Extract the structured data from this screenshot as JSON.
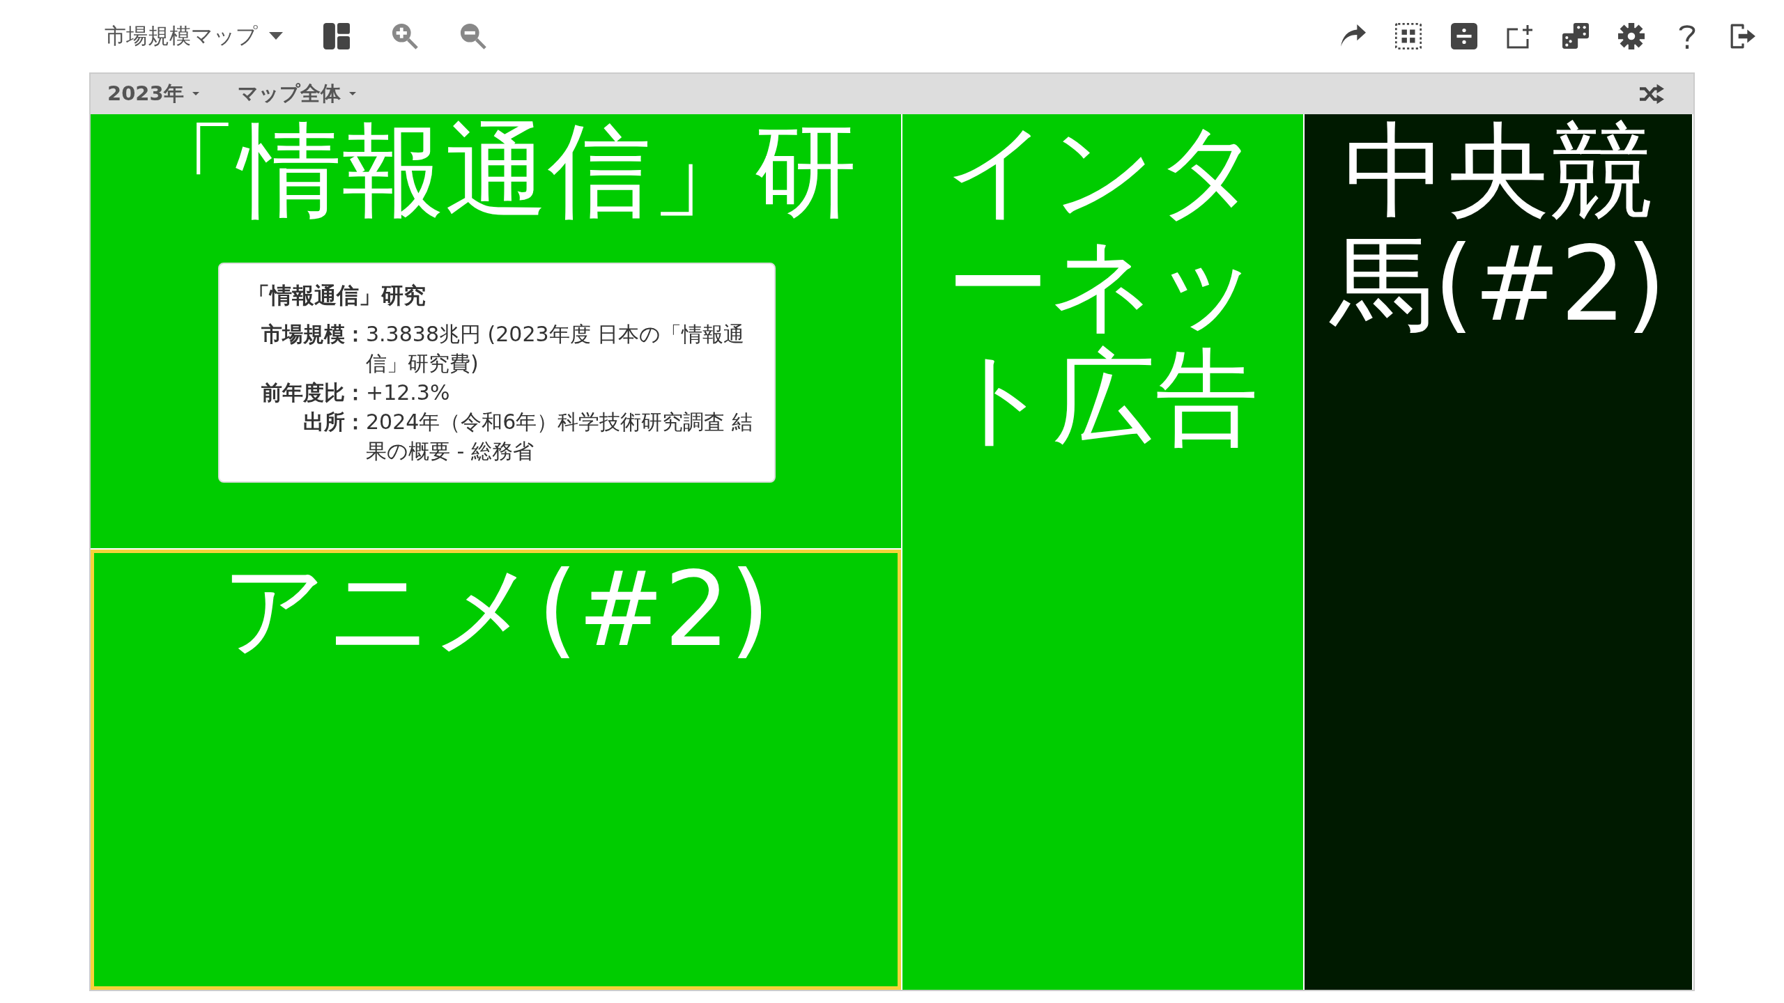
{
  "toolbar": {
    "map_menu": "市場規模マップ"
  },
  "subbar": {
    "year_menu": "2023年",
    "scope_menu": "マップ全体"
  },
  "treemap": {
    "columns": [
      {
        "tiles": [
          {
            "label": "「情報通信」研",
            "color": "#00cc00",
            "selected": false
          },
          {
            "label": "アニメ(#2)",
            "color": "#00cc00",
            "selected": true
          }
        ]
      },
      {
        "tiles": [
          {
            "label": "インターネット広告",
            "color": "#00cc00",
            "selected": false
          }
        ]
      },
      {
        "tiles": [
          {
            "label": "中央競馬(#2)",
            "color": "#001a00",
            "selected": false
          }
        ]
      }
    ]
  },
  "tooltip": {
    "title": "「情報通信」研究",
    "rows": [
      {
        "label": "市場規模：",
        "value": "3.3838兆円 (2023年度 日本の「情報通信」研究費)"
      },
      {
        "label": "前年度比：",
        "value": "+12.3%"
      },
      {
        "label": "出所：",
        "value": "2024年（令和6年）科学技術研究調査 結果の概要 - 総務省"
      }
    ]
  }
}
